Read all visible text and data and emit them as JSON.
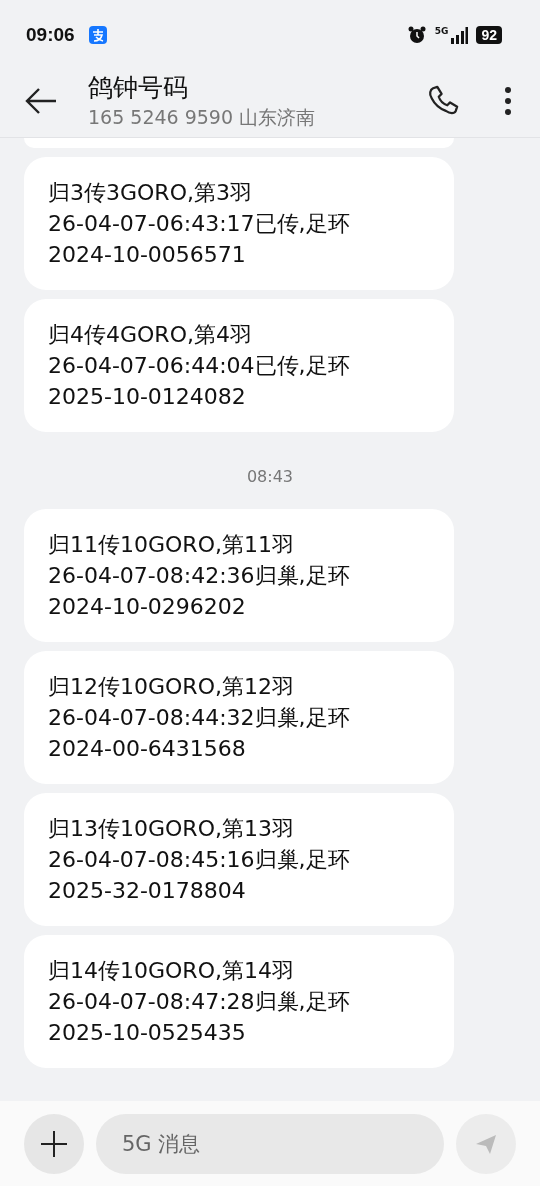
{
  "status_bar": {
    "time": "09:06",
    "network": "5G",
    "battery": "92"
  },
  "header": {
    "title": "鸽钟号码",
    "subtitle": "165 5246 9590  山东济南"
  },
  "thread": [
    {
      "kind": "message",
      "lines": [
        "归3传3GORO,第3羽",
        "26-04-07-06:43:17已传,足环",
        "2024-10-0056571"
      ]
    },
    {
      "kind": "message",
      "lines": [
        "归4传4GORO,第4羽",
        "26-04-07-06:44:04已传,足环",
        "2025-10-0124082"
      ]
    },
    {
      "kind": "time",
      "text": "08:43"
    },
    {
      "kind": "message",
      "lines": [
        "归11传10GORO,第11羽",
        "26-04-07-08:42:36归巢,足环",
        "2024-10-0296202"
      ]
    },
    {
      "kind": "message",
      "lines": [
        "归12传10GORO,第12羽",
        "26-04-07-08:44:32归巢,足环",
        "2024-00-6431568"
      ]
    },
    {
      "kind": "message",
      "lines": [
        "归13传10GORO,第13羽",
        "26-04-07-08:45:16归巢,足环",
        "2025-32-0178804"
      ]
    },
    {
      "kind": "message",
      "lines": [
        "归14传10GORO,第14羽",
        "26-04-07-08:47:28归巢,足环",
        "2025-10-0525435"
      ]
    }
  ],
  "composer": {
    "placeholder": "5G 消息"
  }
}
